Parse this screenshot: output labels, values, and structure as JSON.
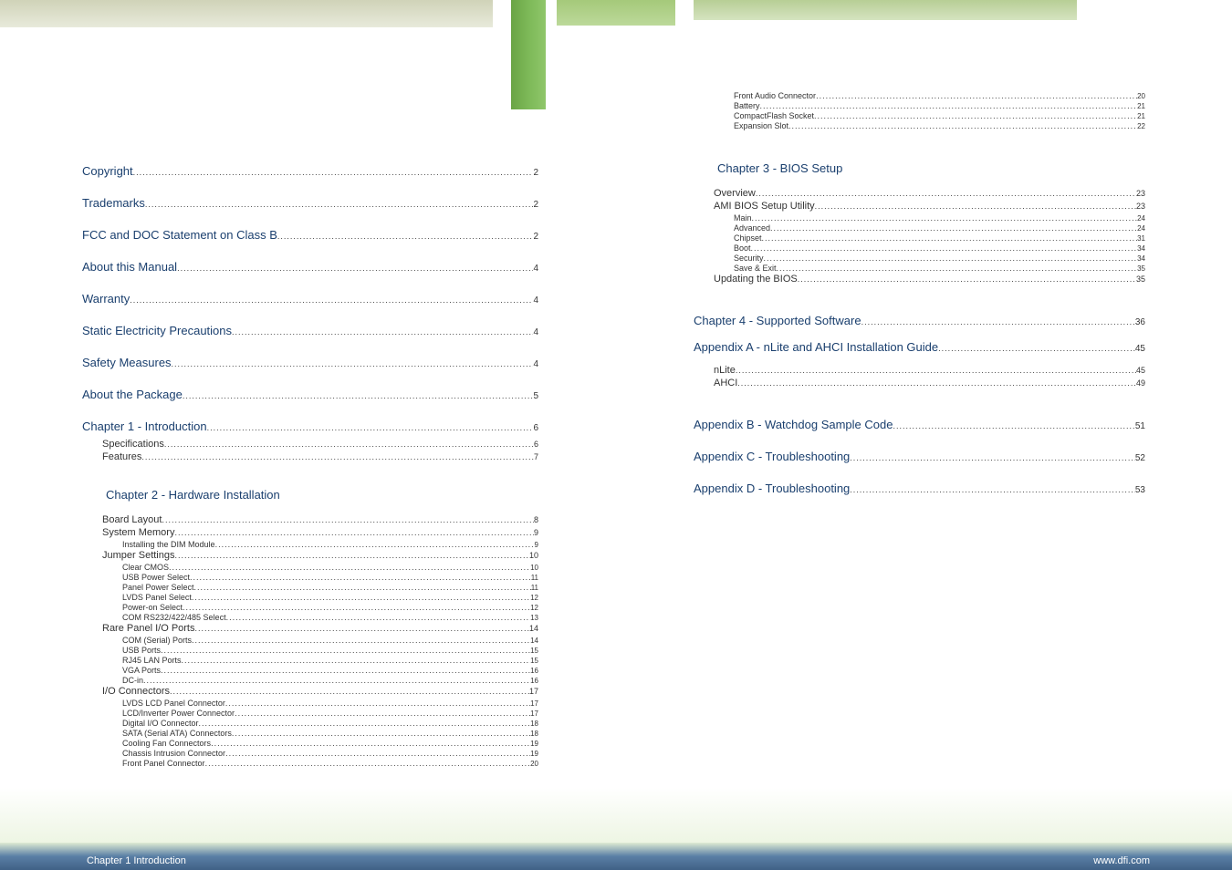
{
  "header": {},
  "left_column": {
    "top_entries": [
      {
        "label": "Copyright",
        "page": "2",
        "level": 0
      },
      {
        "label": "Trademarks",
        "page": "2",
        "level": 0
      },
      {
        "label": "FCC and DOC Statement on Class B",
        "page": "2",
        "level": 0
      },
      {
        "label": "About this Manual",
        "page": "4",
        "level": 0
      },
      {
        "label": "Warranty",
        "page": "4",
        "level": 0
      },
      {
        "label": "Static Electricity Precautions",
        "page": "4",
        "level": 0
      },
      {
        "label": "Safety Measures",
        "page": "4",
        "level": 0
      },
      {
        "label": "About the Package",
        "page": "5",
        "level": 0
      },
      {
        "label": "Chapter 1 - Introduction",
        "page": "6",
        "level": 0
      }
    ],
    "ch1_sub": [
      {
        "label": "Specifications",
        "page": "6",
        "level": 1
      },
      {
        "label": "Features",
        "page": "7",
        "level": 1
      }
    ],
    "ch2_title": "Chapter 2 - Hardware Installation",
    "ch2_entries": [
      {
        "label": "Board Layout",
        "page": "8",
        "level": 1
      },
      {
        "label": "System Memory",
        "page": "9",
        "level": 1
      },
      {
        "label": "Installing the DIM Module",
        "page": "9",
        "level": 2
      },
      {
        "label": "Jumper Settings",
        "page": "10",
        "level": 1
      },
      {
        "label": "Clear CMOS",
        "page": "10",
        "level": 2
      },
      {
        "label": "USB Power Select",
        "page": "11",
        "level": 2
      },
      {
        "label": "Panel Power Select",
        "page": "11",
        "level": 2
      },
      {
        "label": "LVDS Panel Select",
        "page": "12",
        "level": 2
      },
      {
        "label": "Power-on Select",
        "page": "12",
        "level": 2
      },
      {
        "label": "COM RS232/422/485 Select",
        "page": "13",
        "level": 2
      },
      {
        "label": "Rare Panel I/O Ports",
        "page": "14",
        "level": 1
      },
      {
        "label": "COM (Serial) Ports",
        "page": "14",
        "level": 2
      },
      {
        "label": "USB Ports",
        "page": "15",
        "level": 2
      },
      {
        "label": "RJ45 LAN Ports",
        "page": "15",
        "level": 2
      },
      {
        "label": "VGA Ports",
        "page": "16",
        "level": 2
      },
      {
        "label": "DC-in",
        "page": "16",
        "level": 2
      },
      {
        "label": "I/O Connectors",
        "page": "17",
        "level": 1
      },
      {
        "label": "LVDS LCD Panel Connector",
        "page": "17",
        "level": 2
      },
      {
        "label": "LCD/Inverter Power Connector",
        "page": "17",
        "level": 2
      },
      {
        "label": "Digital I/O Connector",
        "page": "18",
        "level": 2
      },
      {
        "label": "SATA (Serial ATA) Connectors",
        "page": "18",
        "level": 2
      },
      {
        "label": "Cooling Fan Connectors",
        "page": "19",
        "level": 2
      },
      {
        "label": "Chassis Intrusion Connector",
        "page": "19",
        "level": 2
      },
      {
        "label": "Front Panel Connector",
        "page": "20",
        "level": 2
      }
    ]
  },
  "right_column": {
    "cont_entries": [
      {
        "label": "Front Audio Connector",
        "page": "20",
        "level": 2
      },
      {
        "label": "Battery",
        "page": "21",
        "level": 2
      },
      {
        "label": "CompactFlash Socket",
        "page": "21",
        "level": 2
      },
      {
        "label": "Expansion Slot",
        "page": "22",
        "level": 2
      }
    ],
    "ch3_title": "Chapter 3 - BIOS Setup",
    "ch3_entries": [
      {
        "label": "Overview",
        "page": "23",
        "level": 1
      },
      {
        "label": "AMI BIOS Setup Utility",
        "page": "23",
        "level": 1
      },
      {
        "label": "Main",
        "page": "24",
        "level": 2
      },
      {
        "label": "Advanced",
        "page": "24",
        "level": 2
      },
      {
        "label": "Chipset",
        "page": "31",
        "level": 2
      },
      {
        "label": "Boot",
        "page": "34",
        "level": 2
      },
      {
        "label": "Security",
        "page": "34",
        "level": 2
      },
      {
        "label": "Save & Exit",
        "page": "35",
        "level": 2
      },
      {
        "label": "Updating the BIOS",
        "page": "35",
        "level": 1
      }
    ],
    "ch4_entry": {
      "label": "Chapter 4 - Supported Software",
      "page": "36",
      "level": 0
    },
    "appA_entry": {
      "label": "Appendix A - nLite and AHCI Installation Guide",
      "page": "45",
      "level": 0
    },
    "appA_sub": [
      {
        "label": "nLite",
        "page": "45",
        "level": 1
      },
      {
        "label": "AHCI",
        "page": "49",
        "level": 1
      }
    ],
    "app_rest": [
      {
        "label": "Appendix B - Watchdog Sample Code",
        "page": "51",
        "level": 0
      },
      {
        "label": "Appendix C - Troubleshooting",
        "page": "52",
        "level": 0
      },
      {
        "label": "Appendix D - Troubleshooting",
        "page": "53",
        "level": 0
      }
    ]
  },
  "footer": {
    "left": "Chapter 1 Introduction",
    "right": "www.dfi.com"
  }
}
